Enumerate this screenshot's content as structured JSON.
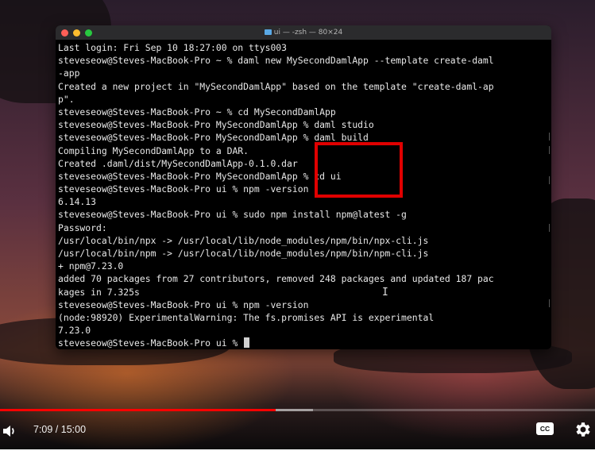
{
  "terminal": {
    "title": "ui — -zsh — 80×24",
    "lines": [
      "Last login: Fri Sep 10 18:27:00 on ttys003",
      "steveseow@Steves-MacBook-Pro ~ % daml new MySecondDamlApp --template create-daml",
      "-app",
      "Created a new project in \"MySecondDamlApp\" based on the template \"create-daml-ap",
      "p\".",
      "steveseow@Steves-MacBook-Pro ~ % cd MySecondDamlApp",
      "steveseow@Steves-MacBook-Pro MySecondDamlApp % daml studio",
      "steveseow@Steves-MacBook-Pro MySecondDamlApp % daml build",
      "Compiling MySecondDamlApp to a DAR.",
      "Created .daml/dist/MySecondDamlApp-0.1.0.dar",
      "steveseow@Steves-MacBook-Pro MySecondDamlApp % cd ui",
      "steveseow@Steves-MacBook-Pro ui % npm -version",
      "6.14.13",
      "steveseow@Steves-MacBook-Pro ui % sudo npm install npm@latest -g",
      "Password:",
      "/usr/local/bin/npx -> /usr/local/lib/node_modules/npm/bin/npx-cli.js",
      "/usr/local/bin/npm -> /usr/local/lib/node_modules/npm/bin/npm-cli.js",
      "+ npm@7.23.0",
      "added 70 packages from 27 contributors, removed 248 packages and updated 187 pac",
      "kages in 7.325s",
      "steveseow@Steves-MacBook-Pro ui % npm -version",
      "(node:98920) ExperimentalWarning: The fs.promises API is experimental",
      "7.23.0",
      "steveseow@Steves-MacBook-Pro ui % "
    ]
  },
  "player": {
    "time_display": "7:09 / 15:00",
    "progress_played": 0.463,
    "progress_buffered": 0.526,
    "cc_label": "CC",
    "accent_color": "#ff0000",
    "highlight_color": "#e00000",
    "icons": [
      "volume-icon",
      "cc-icon",
      "gear-icon"
    ]
  }
}
